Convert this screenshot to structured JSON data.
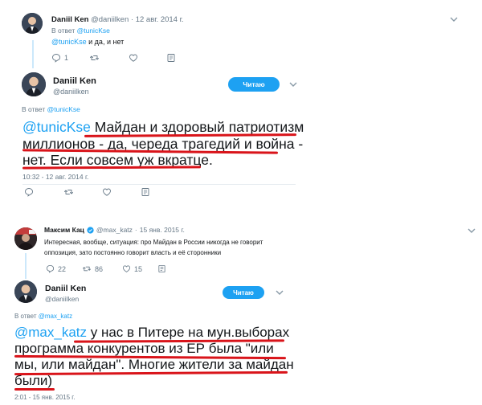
{
  "tweet1": {
    "name": "Daniil Ken",
    "handle": "@daniilken",
    "date": "12 авг. 2014 г.",
    "reply_label": "В ответ",
    "reply_to": "@tunicKse",
    "text_mention": "@tunicKse",
    "text_body": " и да, и нет",
    "reply_count": "1",
    "retweet_count": "",
    "like_count": ""
  },
  "tweet2": {
    "name": "Daniil Ken",
    "handle": "@daniilken",
    "follow_label": "Читаю",
    "reply_label": "В ответ",
    "reply_to": "@tunicKse",
    "text_mention": "@tunicKse",
    "text_line1": " Майдан и здоровый патриотизм",
    "text_line2": "миллионов - да, череда трагедий и война -",
    "text_line3": "нет. Если совсем уж вкратце.",
    "timestamp": "10:32 - 12 авг. 2014 г."
  },
  "tweet3": {
    "name": "Максим Кац",
    "handle": "@max_katz",
    "date": "15 янв. 2015 г.",
    "text_line1": "Интересная, вообще, ситуация: про Майдан в России никогда не говорит",
    "text_line2": "оппозиция, зато постоянно говорит власть и её сторонники",
    "reply_count": "22",
    "retweet_count": "86",
    "like_count": "15"
  },
  "tweet4": {
    "name": "Daniil Ken",
    "handle": "@daniilken",
    "follow_label": "Читаю",
    "reply_label": "В ответ",
    "reply_to": "@max_katz",
    "text_mention": "@max_katz",
    "text_line1": " у нас в Питере на мун.выборах",
    "text_line2": "программа конкурентов из ЕР была \"или",
    "text_line3": "мы, или майдан\". Многие жители за майдан",
    "text_line4": "были)",
    "timestamp": "2:01 - 15 янв. 2015 г."
  },
  "colors": {
    "accent": "#1da1f2",
    "muted": "#657786",
    "underline": "#d9141a"
  },
  "icons": [
    "reply-icon",
    "retweet-icon",
    "like-icon",
    "dm-icon",
    "verified-icon",
    "chevron-down-icon"
  ]
}
